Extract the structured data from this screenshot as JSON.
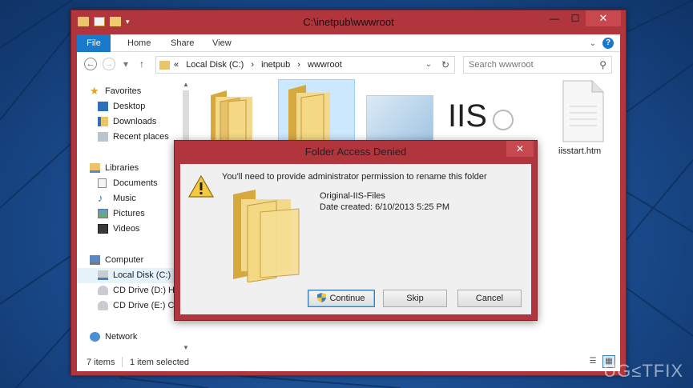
{
  "window": {
    "title": "C:\\inetpub\\wwwroot",
    "minimize": "—",
    "maximize": "☐",
    "close": "✕"
  },
  "ribbon": {
    "file": "File",
    "home": "Home",
    "share": "Share",
    "view": "View"
  },
  "address": {
    "crumbs": [
      "«",
      "Local Disk (C:)",
      "›",
      "inetpub",
      "›",
      "wwwroot"
    ],
    "search_placeholder": "Search wwwroot"
  },
  "navpane": {
    "favorites": "Favorites",
    "desktop": "Desktop",
    "downloads": "Downloads",
    "recent": "Recent places",
    "libraries": "Libraries",
    "documents": "Documents",
    "music": "Music",
    "pictures": "Pictures",
    "videos": "Videos",
    "computer": "Computer",
    "local_disk": "Local Disk (C:)",
    "cd_d": "CD Drive (D:) H",
    "cd_e": "CD Drive (E:) CD",
    "network": "Network"
  },
  "content": {
    "file_label": "iisstart.htm",
    "iis_text": "IIS"
  },
  "status": {
    "items": "7 items",
    "selected": "1 item selected"
  },
  "dialog": {
    "title": "Folder Access Denied",
    "close": "✕",
    "message": "You'll need to provide administrator permission to rename this folder",
    "folder_name": "Original-IIS-Files",
    "date_created": "Date created: 6/10/2013 5:25 PM",
    "continue": "Continue",
    "skip": "Skip",
    "cancel": "Cancel"
  },
  "watermark": "UG≤TFIX",
  "colors": {
    "frame": "#b0353d",
    "accent": "#1979ca",
    "folder": "#e9c46a",
    "desktop": "#1b4f91"
  }
}
